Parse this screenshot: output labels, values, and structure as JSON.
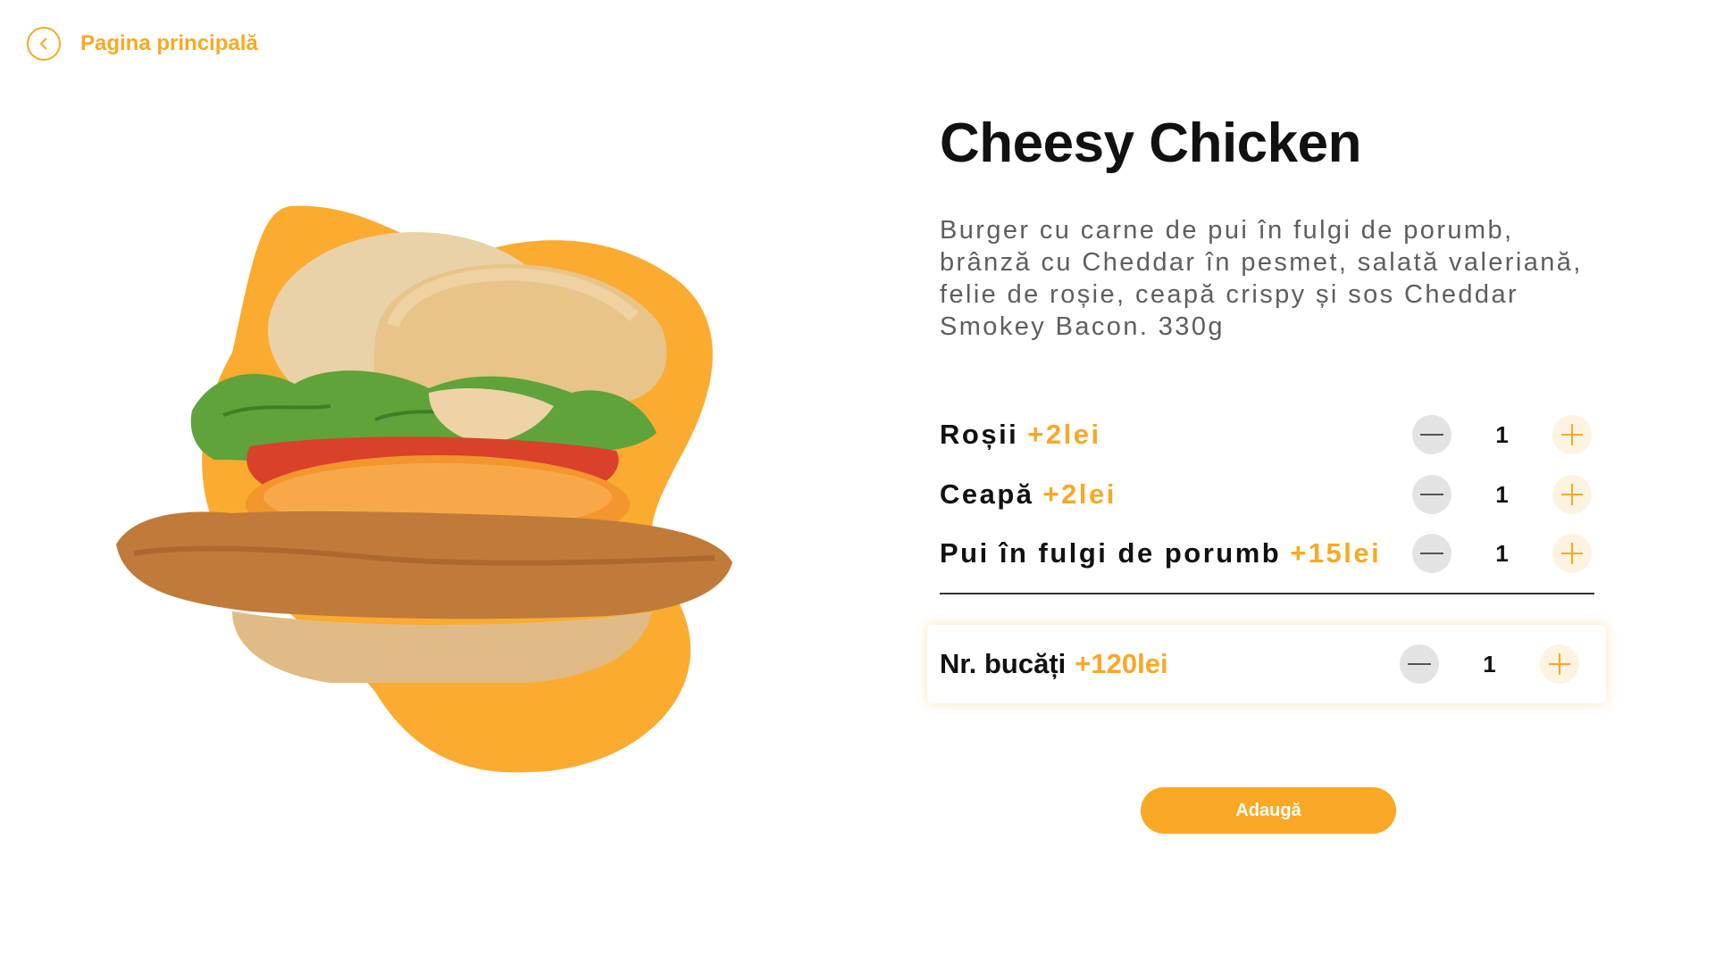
{
  "nav": {
    "back_label": "Pagina principală"
  },
  "product": {
    "title": "Cheesy Chicken",
    "description": "Burger cu carne de pui în fulgi de porumb, brânză cu Cheddar în pesmet, salată valeriană, felie de roșie, ceapă crispy și sos Cheddar Smokey Bacon. 330g",
    "image_icon": "burger-image"
  },
  "options": [
    {
      "name": "Roșii",
      "price": "+2lei",
      "quantity": "1"
    },
    {
      "name": "Ceapă",
      "price": "+2lei",
      "quantity": "1"
    },
    {
      "name": "Pui în fulgi de porumb",
      "price": "+15lei",
      "quantity": "1"
    }
  ],
  "pieces": {
    "label": "Nr. bucăți",
    "price": "+120lei",
    "quantity": "1"
  },
  "actions": {
    "add_label": "Adaugă"
  },
  "colors": {
    "accent": "#F9A825",
    "minus_bg": "#E3E3E3",
    "plus_bg": "#FEF3E0",
    "text": "#111111"
  }
}
